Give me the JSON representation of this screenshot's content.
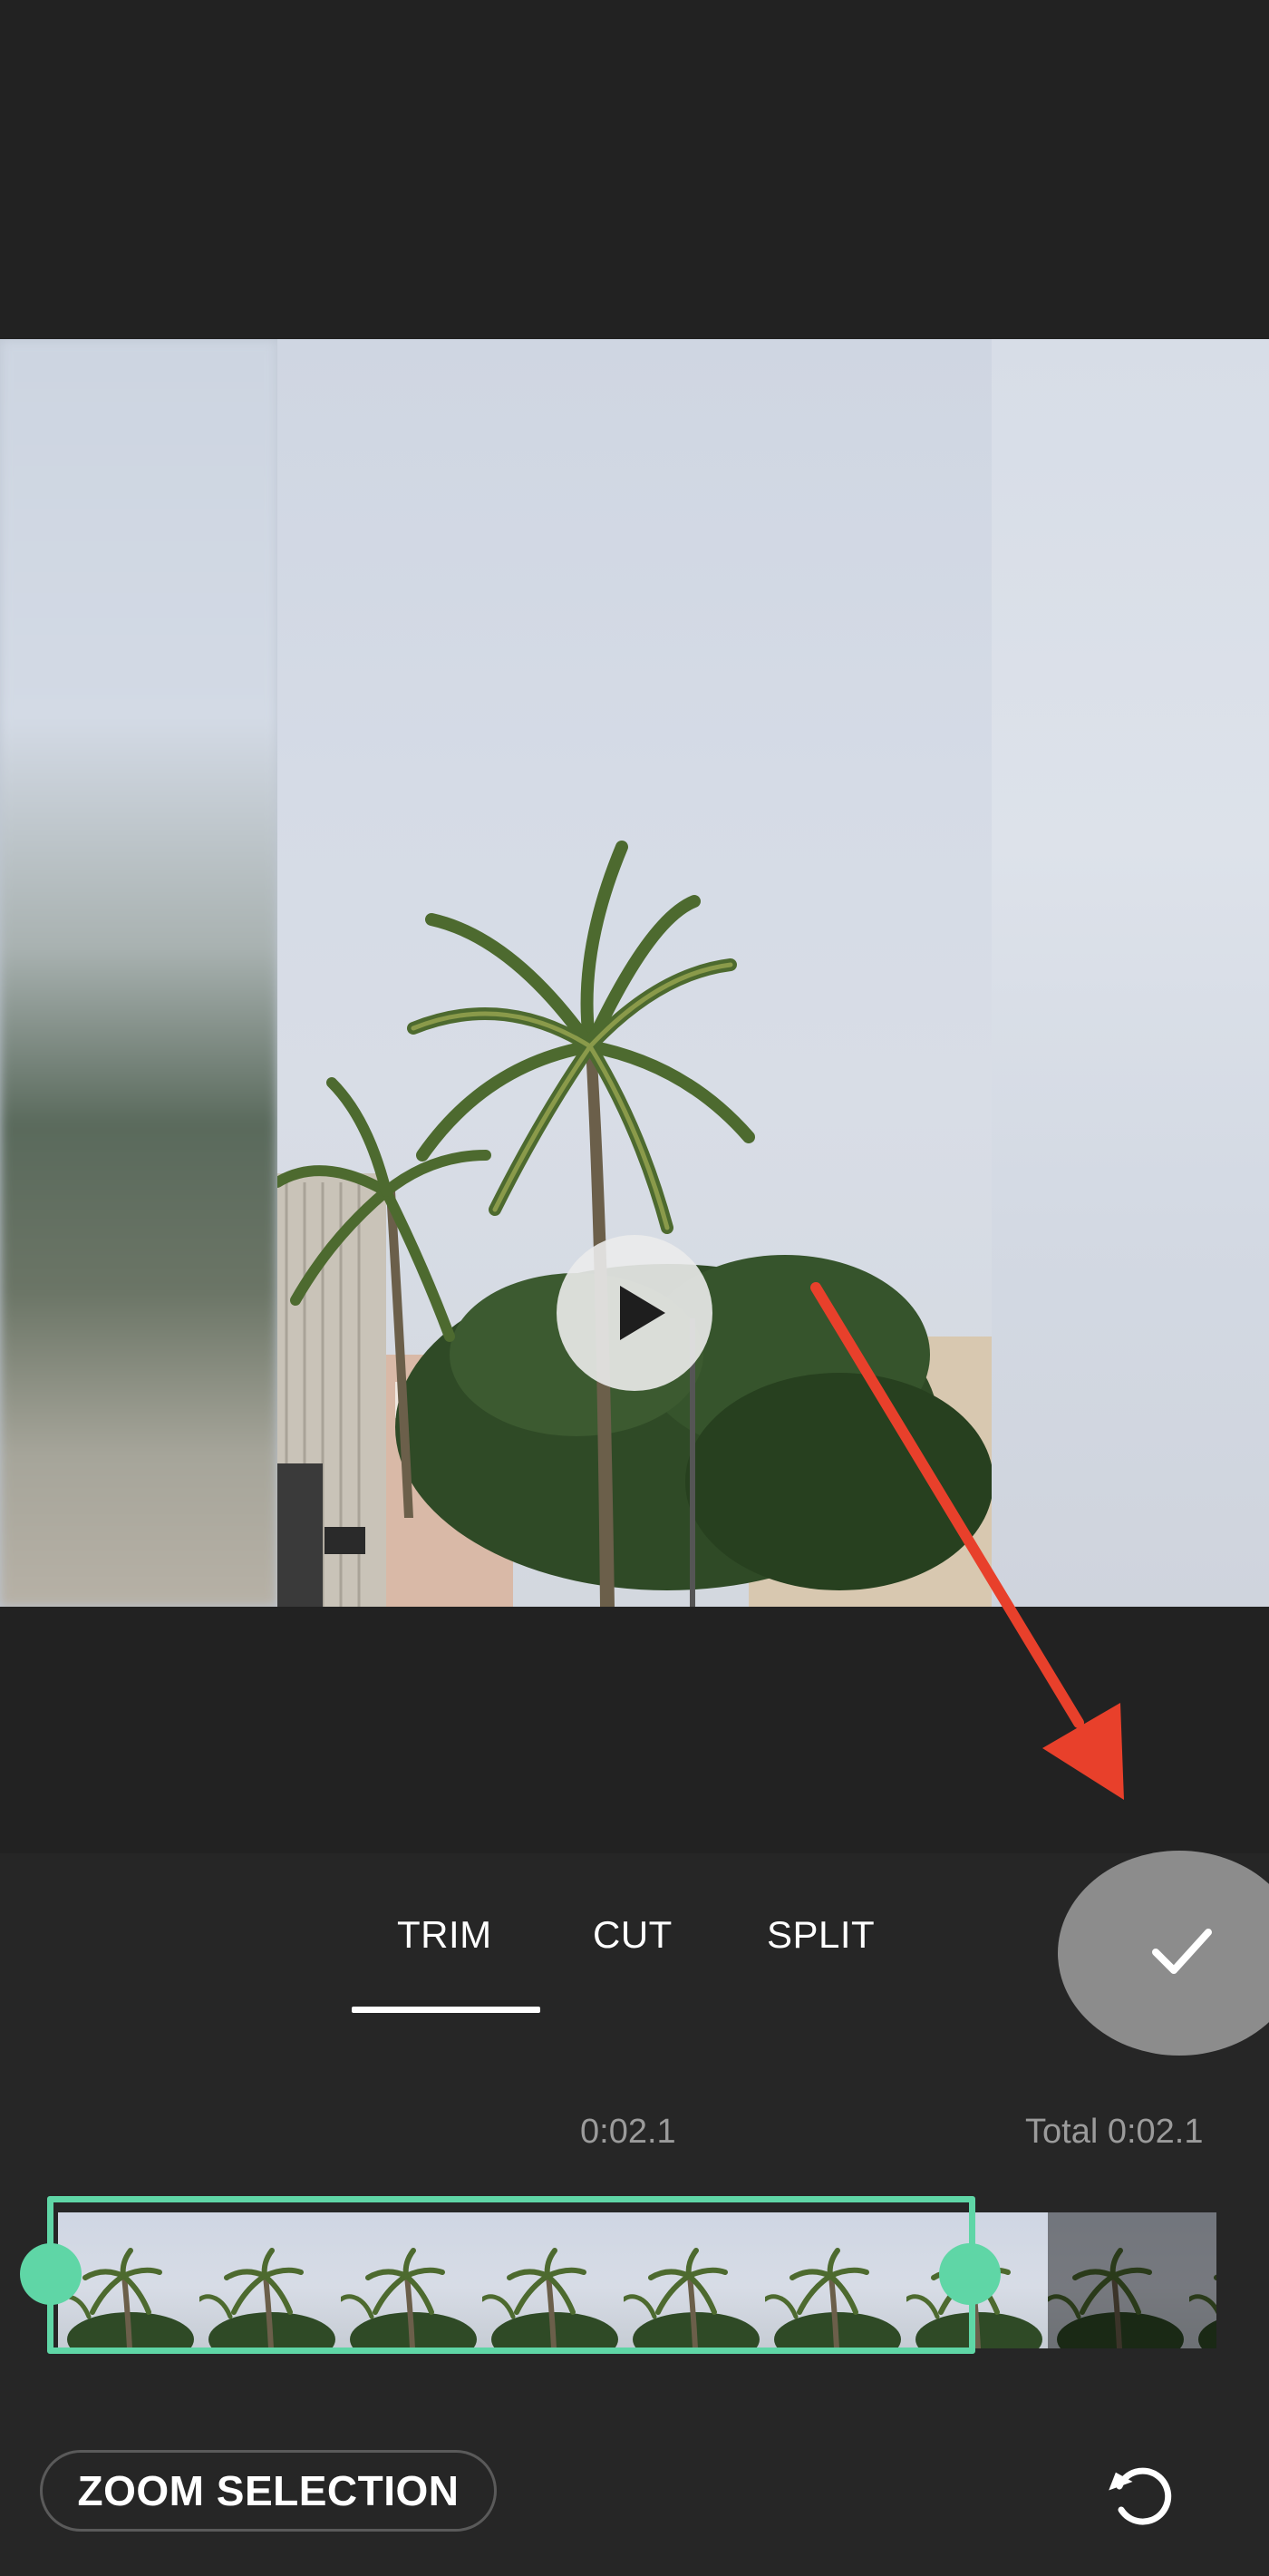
{
  "colors": {
    "background": "#222222",
    "panel": "#262626",
    "accent": "#5fd6a6",
    "confirm_button": "#8c8c8c",
    "annotation_arrow": "#e8402b",
    "secondary_text": "#9b9b9b"
  },
  "preview": {
    "play_icon": "play-icon"
  },
  "tabs": [
    {
      "label": "TRIM",
      "selected": true
    },
    {
      "label": "CUT",
      "selected": false
    },
    {
      "label": "SPLIT",
      "selected": false
    }
  ],
  "confirm_icon": "check-icon",
  "timeline": {
    "current_time": "0:02.1",
    "total_time": "Total 0:02.1",
    "thumbnail_count": 9,
    "selected_thumbnail_count": 7
  },
  "footer": {
    "zoom_label": "ZOOM SELECTION",
    "reset_icon": "reset-icon"
  },
  "annotation": {
    "type": "arrow",
    "points_to": "confirm-button"
  }
}
